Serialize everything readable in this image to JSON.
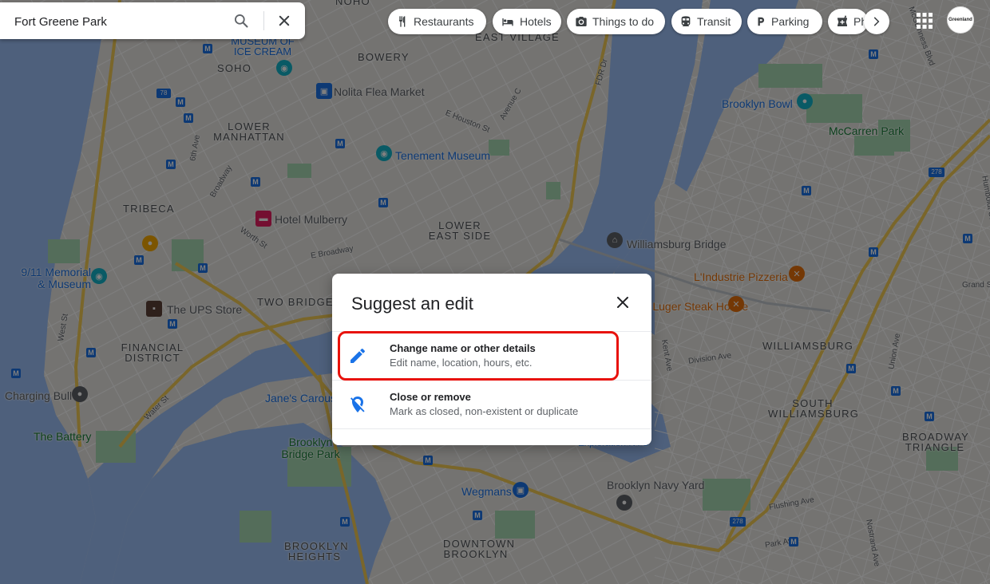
{
  "search": {
    "value": "Fort Greene Park"
  },
  "chips": [
    {
      "label": "Restaurants",
      "icon": "restaurant-icon"
    },
    {
      "label": "Hotels",
      "icon": "hotel-icon"
    },
    {
      "label": "Things to do",
      "icon": "camera-icon"
    },
    {
      "label": "Transit",
      "icon": "transit-icon"
    },
    {
      "label": "Parking",
      "icon": "parking-icon"
    },
    {
      "label": "Ph",
      "icon": "pharmacy-icon"
    }
  ],
  "account": {
    "avatar_text": "Greenland"
  },
  "dialog": {
    "title": "Suggest an edit",
    "options": [
      {
        "title": "Change name or other details",
        "subtitle": "Edit name, location, hours, etc.",
        "icon": "pencil-icon"
      },
      {
        "title": "Close or remove",
        "subtitle": "Mark as closed, non-existent or duplicate",
        "icon": "location-off-icon"
      }
    ]
  },
  "map": {
    "areas": [
      "NOHO",
      "EAST VILLAGE",
      "SOHO",
      "BOWERY",
      "LOWER MANHATTAN",
      "TRIBECA",
      "LOWER EAST SIDE",
      "TWO BRIDGES",
      "FINANCIAL DISTRICT",
      "WILLIAMSBURG",
      "SOUTH WILLIAMSBURG",
      "BROADWAY TRIANGLE",
      "BROOKLYN HEIGHTS",
      "DOWNTOWN BROOKLYN"
    ],
    "pois": [
      "MUSEUM OF ICE CREAM",
      "Nolita Flea Market",
      "Tenement Museum",
      "Hotel Mulberry",
      "Williamsburg Bridge",
      "L'Industrie Pizzeria",
      "Peter Luger Steak House",
      "Brooklyn Bowl",
      "McCarren Park",
      "9/11 Memorial & Museum",
      "The UPS Store",
      "Charging Bull",
      "The Battery",
      "Jane's Carousel",
      "Brooklyn Bridge Park",
      "Wegmans",
      "Brooklyn Navy Yard",
      "Exploration NYC"
    ],
    "streets": [
      "E Houston St",
      "Avenue C",
      "FDR Dr",
      "6th Ave",
      "Broadway",
      "Worth St",
      "E Broadway",
      "West St",
      "Water St",
      "Kent Ave",
      "Division Ave",
      "Union Ave",
      "Grand St",
      "Flushing Ave",
      "Park Ave",
      "Nostrand Ave",
      "Humboldt St",
      "McGuinness Blvd"
    ],
    "route_shields": [
      "78",
      "278",
      "278"
    ]
  }
}
